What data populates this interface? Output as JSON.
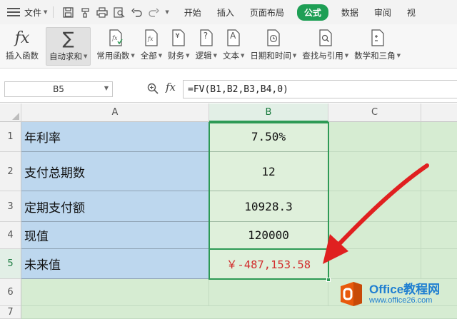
{
  "menubar": {
    "file_label": "文件",
    "tabs": [
      {
        "label": "开始",
        "active": false
      },
      {
        "label": "插入",
        "active": false
      },
      {
        "label": "页面布局",
        "active": false
      },
      {
        "label": "公式",
        "active": true
      },
      {
        "label": "数据",
        "active": false
      },
      {
        "label": "审阅",
        "active": false
      },
      {
        "label": "视",
        "active": false
      }
    ]
  },
  "ribbon": {
    "insert_function": "插入函数",
    "autosum": "自动求和",
    "common_functions": "常用函数",
    "all": "全部",
    "finance": "财务",
    "logic": "逻辑",
    "text": "文本",
    "datetime": "日期和时间",
    "lookup": "查找与引用",
    "math": "数学和三角",
    "fx_glyph": "fx",
    "sigma_glyph": "∑",
    "yen_glyph": "¥",
    "question_glyph": "?",
    "letter_glyph": "A"
  },
  "formula_bar": {
    "name_box": "B5",
    "fx_label": "fx",
    "formula": "=FV(B1,B2,B3,B4,0)"
  },
  "sheet": {
    "columns": [
      "A",
      "B",
      "C"
    ],
    "rows": [
      {
        "num": "1",
        "label": "年利率",
        "value": "7.50%"
      },
      {
        "num": "2",
        "label": "支付总期数",
        "value": "12"
      },
      {
        "num": "3",
        "label": "定期支付额",
        "value": "10928.3"
      },
      {
        "num": "4",
        "label": "现值",
        "value": "120000"
      },
      {
        "num": "5",
        "label": "未来值",
        "value": "￥-487,153.58"
      },
      {
        "num": "6",
        "label": "",
        "value": ""
      },
      {
        "num": "7",
        "label": "",
        "value": ""
      }
    ],
    "selected_cell": "B5"
  },
  "watermark": {
    "line1": "Office教程网",
    "line2": "www.office26.com"
  },
  "colors": {
    "accent": "#1e9f55",
    "arrow": "#e02020",
    "result_text": "#d22d2d",
    "col_a_fill": "#bdd7ee",
    "col_b_fill": "#dff0db"
  }
}
